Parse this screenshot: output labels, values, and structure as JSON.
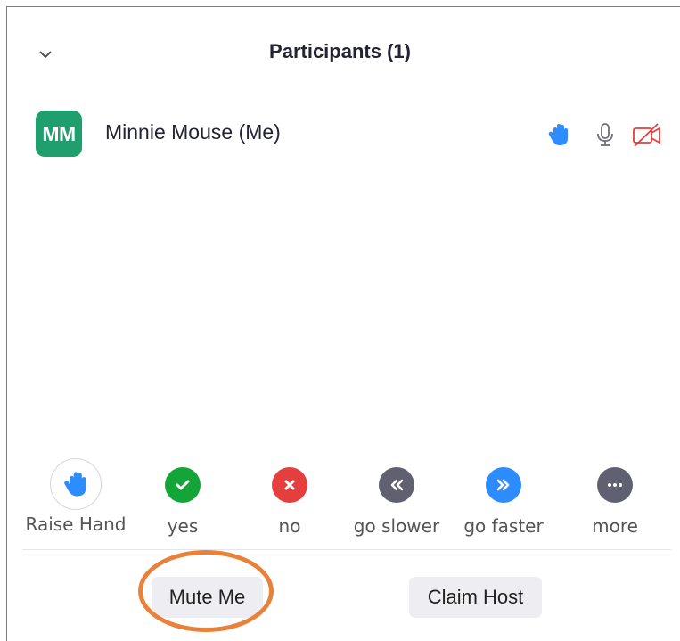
{
  "header": {
    "title": "Participants (1)",
    "collapse_icon": "chevron-down-icon"
  },
  "participants": [
    {
      "initials": "MM",
      "name": "Minnie Mouse (Me)",
      "avatar_color": "#1f9e6e",
      "status_icons": [
        "raised-hand-icon",
        "microphone-icon",
        "video-off-icon"
      ]
    }
  ],
  "reactions": [
    {
      "label": "Raise Hand",
      "icon": "raise-hand-icon",
      "color": "#2d8cff"
    },
    {
      "label": "yes",
      "icon": "checkmark-icon",
      "color": "#13a538"
    },
    {
      "label": "no",
      "icon": "x-icon",
      "color": "#e53e3e"
    },
    {
      "label": "go slower",
      "icon": "rewind-icon",
      "color": "#5f6170"
    },
    {
      "label": "go faster",
      "icon": "fast-forward-icon",
      "color": "#2d8cff"
    },
    {
      "label": "more",
      "icon": "ellipsis-icon",
      "color": "#5f6170"
    }
  ],
  "footer": {
    "mute_label": "Mute Me",
    "claim_host_label": "Claim Host"
  },
  "colors": {
    "accent_blue": "#2d8cff",
    "video_off_red": "#e53e3e",
    "highlight_orange": "#e8823a"
  }
}
